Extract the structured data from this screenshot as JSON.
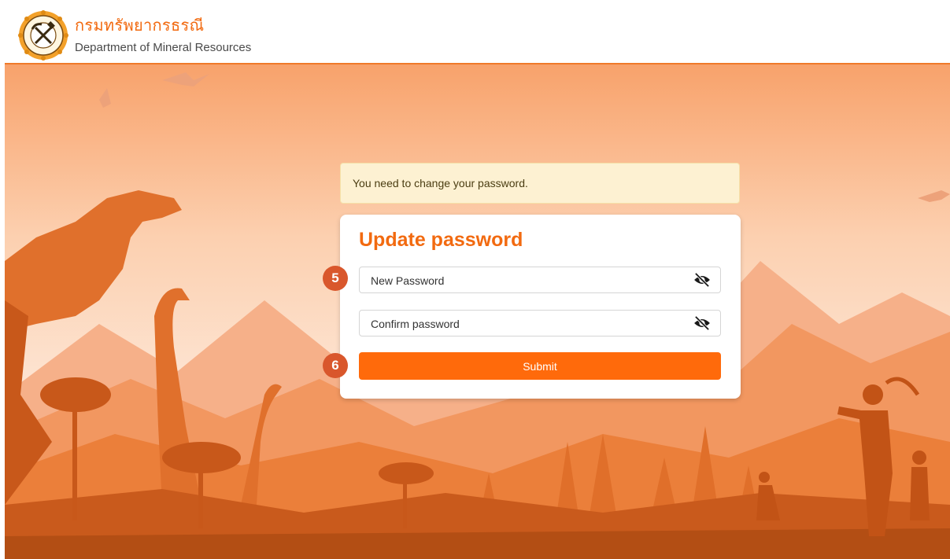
{
  "header": {
    "title_th": "กรมทรัพยากรธรณี",
    "title_en": "Department of Mineral Resources",
    "logo_icon": "dmr-seal-icon"
  },
  "alert": {
    "message": "You need to change your password."
  },
  "form": {
    "title": "Update password",
    "new_password": {
      "placeholder": "New Password",
      "value": ""
    },
    "confirm_password": {
      "placeholder": "Confirm password",
      "value": ""
    },
    "toggle_icon": "eye-slash-icon",
    "submit_label": "Submit"
  },
  "annotations": {
    "step_new_password": "5",
    "step_submit": "6"
  },
  "colors": {
    "accent": "#f26a10",
    "button": "#ff6a0b",
    "badge": "#d9572c",
    "alert_bg": "#fdf1d2"
  }
}
